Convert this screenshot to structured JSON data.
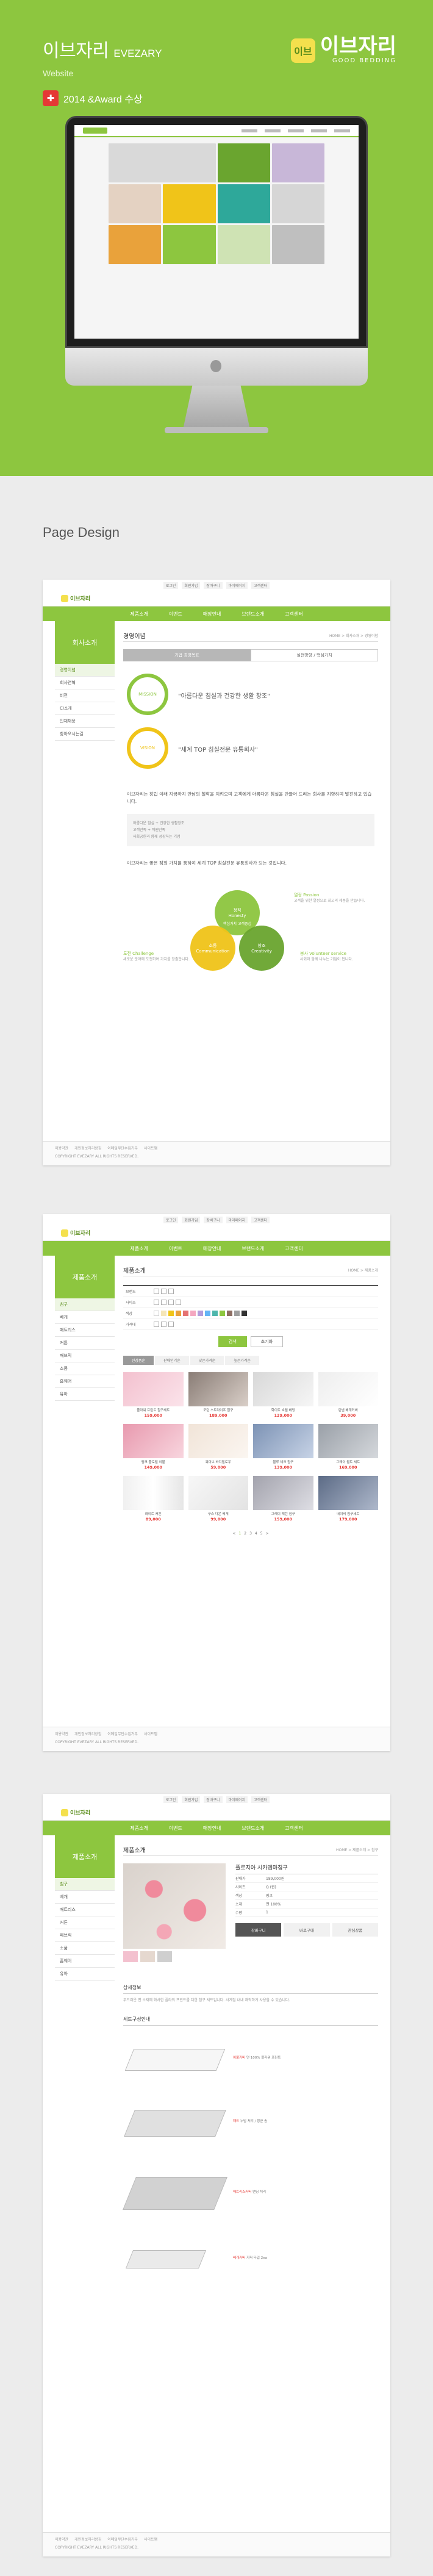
{
  "hero": {
    "title": "이브자리",
    "title_en": "EVEZARY",
    "subtitle": "Website",
    "award": "2014 &Award 수상",
    "brand_mark": "이브",
    "brand_name": "이브자리",
    "brand_tag": "GOOD BEDDING"
  },
  "section_label": "Page Design",
  "shared": {
    "topbar": [
      "로그인",
      "회원가입",
      "장바구니",
      "마이페이지",
      "고객센터"
    ],
    "logo": "이브자리",
    "nav": [
      "제품소개",
      "이벤트",
      "매장안내",
      "브랜드소개",
      "고객센터"
    ],
    "footer_links": [
      "이용약관",
      "개인정보처리방침",
      "이메일무단수집거부",
      "사이트맵"
    ],
    "footer_copy": "COPYRIGHT EVEZARY ALL RIGHTS RESERVED."
  },
  "page1": {
    "side_title": "회사소개",
    "side_items": [
      "경영이념",
      "회사연혁",
      "비전",
      "CI소개",
      "인재채용",
      "찾아오시는길"
    ],
    "title": "경영이념",
    "crumb": "HOME > 회사소개 > 경영이념",
    "tabs": [
      "기업 경영목표",
      "실천방향 / 핵심가치"
    ],
    "mission_label": "MISSION",
    "mission": "\"아름다운 침실과 건강한 생활 창조\"",
    "vision_label": "VISION",
    "vision": "\"세계 TOP 침실전문 유통회사\"",
    "lead": "이브자리는 창립 이래 지금까지 만남의 철학을 지켜오며 고객에게 아름다운 침실을 만들어 드리는 회사를 지향하며 발전하고 있습니다.",
    "box": [
      "아름다운 침실 + 건강한 생활창조",
      "고객만족 + 직원만족",
      "사회공헌과 함께 성장하는 기업"
    ],
    "lead2": "이브자리는 좋은 잠의 가치를 통하여 세계 TOP 침실전문 유통회사가 되는 것입니다.",
    "venn": [
      {
        "t": "정직",
        "s": "Honesty",
        "c": "#8dc63f"
      },
      {
        "t": "소통",
        "s": "Communication",
        "c": "#f0c419"
      },
      {
        "t": "창조",
        "s": "Creativity",
        "c": "#6aa52f"
      }
    ],
    "venn_center": "핵심가치 고객중심",
    "notes": [
      {
        "t": "열정 Passion",
        "d": "고객을 위한 열정으로 최고의 제품을 만듭니다."
      },
      {
        "t": "도전 Challenge",
        "d": "새로운 분야에 도전하여 가치를 창출합니다."
      },
      {
        "t": "봉사 Volunteer service",
        "d": "사회와 함께 나누는 기업이 됩니다."
      }
    ]
  },
  "page2": {
    "side_title": "제품소개",
    "side_items": [
      "침구",
      "베개",
      "매트리스",
      "커튼",
      "패브릭",
      "소품",
      "홈웨어",
      "유아"
    ],
    "title": "제품소개",
    "crumb": "HOME > 제품소개",
    "filters": [
      "브랜드",
      "사이즈",
      "색상",
      "가격대"
    ],
    "search": "검색",
    "reset": "초기화",
    "sort": [
      "신상품순",
      "판매인기순",
      "낮은가격순",
      "높은가격순"
    ],
    "products": [
      {
        "n": "플라워 프린트 침구세트",
        "p": "159,000"
      },
      {
        "n": "모던 스트라이프 침구",
        "p": "189,000"
      },
      {
        "n": "화이트 호텔 베딩",
        "p": "129,000"
      },
      {
        "n": "린넨 베개커버",
        "p": "39,000"
      },
      {
        "n": "핑크 플로럴 이불",
        "p": "149,000"
      },
      {
        "n": "웨이브 바디필로우",
        "p": "59,000"
      },
      {
        "n": "블루 체크 침구",
        "p": "139,000"
      },
      {
        "n": "그레이 퀼트 세트",
        "p": "169,000"
      },
      {
        "n": "화이트 커튼",
        "p": "89,000"
      },
      {
        "n": "구스 다운 베개",
        "p": "99,000"
      },
      {
        "n": "그레이 패턴 침구",
        "p": "159,000"
      },
      {
        "n": "네이비 침구세트",
        "p": "179,000"
      }
    ],
    "pages": [
      "<",
      "1",
      "2",
      "3",
      "4",
      "5",
      ">"
    ]
  },
  "page3": {
    "title": "제품소개",
    "crumb": "HOME > 제품소개 > 침구",
    "name": "플로지아 시카엠마침구",
    "rows": [
      {
        "k": "판매가",
        "v": "189,000원"
      },
      {
        "k": "사이즈",
        "v": "Q (퀸)"
      },
      {
        "k": "색상",
        "v": "핑크"
      },
      {
        "k": "소재",
        "v": "면 100%"
      },
      {
        "k": "수량",
        "v": "1"
      }
    ],
    "btns": [
      "장바구니",
      "바로구매",
      "관심상품"
    ],
    "sect1": "상세정보",
    "desc": "부드러운 면 소재에 화사한 플라워 프린트를 더한 침구 세트입니다. 사계절 내내 쾌적하게 사용할 수 있습니다.",
    "sect2": "세트구성안내",
    "layers": [
      {
        "t": "이불커버",
        "d": "면 100% 플라워 프린트"
      },
      {
        "t": "패드",
        "d": "누빔 처리 / 항균 솜"
      },
      {
        "t": "매트리스커버",
        "d": "밴딩 처리"
      },
      {
        "t": "베개커버",
        "d": "지퍼 타입 2ea"
      }
    ]
  }
}
